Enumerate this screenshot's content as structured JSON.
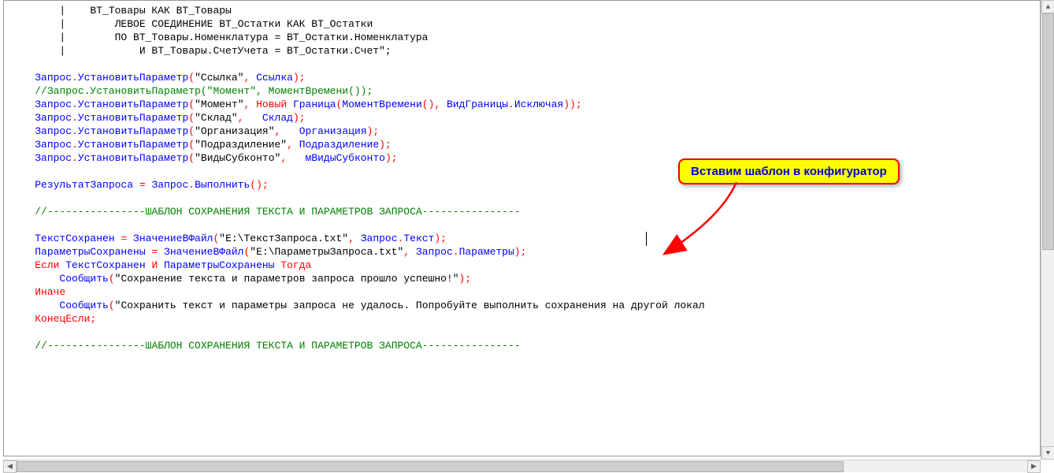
{
  "annotation": {
    "text": "Вставим шаблон в конфигуратор"
  },
  "code": {
    "lines": [
      [
        {
          "c": "black",
          "t": "        |    ВТ_Товары КАК ВТ_Товары"
        }
      ],
      [
        {
          "c": "black",
          "t": "        |        ЛЕВОЕ СОЕДИНЕНИЕ ВТ_Остатки КАК ВТ_Остатки"
        }
      ],
      [
        {
          "c": "black",
          "t": "        |        ПО ВТ_Товары.Номенклатура = ВТ_Остатки.Номенклатура"
        }
      ],
      [
        {
          "c": "black",
          "t": "        |            И ВТ_Товары.СчетУчета = ВТ_Остатки.Счет\""
        },
        {
          "c": "black",
          "t": ";"
        }
      ],
      [
        {
          "c": "black",
          "t": ""
        }
      ],
      [
        {
          "c": "black",
          "t": "    "
        },
        {
          "c": "blue",
          "t": "Запрос"
        },
        {
          "c": "red",
          "t": "."
        },
        {
          "c": "blue",
          "t": "УстановитьПараметр"
        },
        {
          "c": "red",
          "t": "("
        },
        {
          "c": "black",
          "t": "\"Ссылка\""
        },
        {
          "c": "red",
          "t": ", "
        },
        {
          "c": "blue",
          "t": "Ссылка"
        },
        {
          "c": "red",
          "t": ");"
        }
      ],
      [
        {
          "c": "black",
          "t": "    "
        },
        {
          "c": "green",
          "t": "//Запрос.УстановитьПараметр(\"Момент\", МоментВремени());"
        }
      ],
      [
        {
          "c": "black",
          "t": "    "
        },
        {
          "c": "blue",
          "t": "Запрос"
        },
        {
          "c": "red",
          "t": "."
        },
        {
          "c": "blue",
          "t": "УстановитьПараметр"
        },
        {
          "c": "red",
          "t": "("
        },
        {
          "c": "black",
          "t": "\"Момент\""
        },
        {
          "c": "red",
          "t": ", Новый "
        },
        {
          "c": "blue",
          "t": "Граница"
        },
        {
          "c": "red",
          "t": "("
        },
        {
          "c": "blue",
          "t": "МоментВремени"
        },
        {
          "c": "red",
          "t": "(), "
        },
        {
          "c": "blue",
          "t": "ВидГраницы"
        },
        {
          "c": "red",
          "t": "."
        },
        {
          "c": "blue",
          "t": "Исключая"
        },
        {
          "c": "red",
          "t": "));"
        }
      ],
      [
        {
          "c": "black",
          "t": "    "
        },
        {
          "c": "blue",
          "t": "Запрос"
        },
        {
          "c": "red",
          "t": "."
        },
        {
          "c": "blue",
          "t": "УстановитьПараметр"
        },
        {
          "c": "red",
          "t": "("
        },
        {
          "c": "black",
          "t": "\"Склад\""
        },
        {
          "c": "red",
          "t": ",   "
        },
        {
          "c": "blue",
          "t": "Склад"
        },
        {
          "c": "red",
          "t": ");"
        }
      ],
      [
        {
          "c": "black",
          "t": "    "
        },
        {
          "c": "blue",
          "t": "Запрос"
        },
        {
          "c": "red",
          "t": "."
        },
        {
          "c": "blue",
          "t": "УстановитьПараметр"
        },
        {
          "c": "red",
          "t": "("
        },
        {
          "c": "black",
          "t": "\"Организация\""
        },
        {
          "c": "red",
          "t": ",   "
        },
        {
          "c": "blue",
          "t": "Организация"
        },
        {
          "c": "red",
          "t": ");"
        }
      ],
      [
        {
          "c": "black",
          "t": "    "
        },
        {
          "c": "blue",
          "t": "Запрос"
        },
        {
          "c": "red",
          "t": "."
        },
        {
          "c": "blue",
          "t": "УстановитьПараметр"
        },
        {
          "c": "red",
          "t": "("
        },
        {
          "c": "black",
          "t": "\"Подраздиление\""
        },
        {
          "c": "red",
          "t": ", "
        },
        {
          "c": "blue",
          "t": "Подраздиление"
        },
        {
          "c": "red",
          "t": ");"
        }
      ],
      [
        {
          "c": "black",
          "t": "    "
        },
        {
          "c": "blue",
          "t": "Запрос"
        },
        {
          "c": "red",
          "t": "."
        },
        {
          "c": "blue",
          "t": "УстановитьПараметр"
        },
        {
          "c": "red",
          "t": "("
        },
        {
          "c": "black",
          "t": "\"ВидыСубконто\""
        },
        {
          "c": "red",
          "t": ",   "
        },
        {
          "c": "blue",
          "t": "мВидыСубконто"
        },
        {
          "c": "red",
          "t": ");"
        }
      ],
      [
        {
          "c": "black",
          "t": ""
        }
      ],
      [
        {
          "c": "black",
          "t": "    "
        },
        {
          "c": "blue",
          "t": "РезультатЗапроса "
        },
        {
          "c": "red",
          "t": "= "
        },
        {
          "c": "blue",
          "t": "Запрос"
        },
        {
          "c": "red",
          "t": "."
        },
        {
          "c": "blue",
          "t": "Выполнить"
        },
        {
          "c": "red",
          "t": "();"
        }
      ],
      [
        {
          "c": "black",
          "t": ""
        }
      ],
      [
        {
          "c": "black",
          "t": "    "
        },
        {
          "c": "green",
          "t": "//----------------ШАБЛОН СОХРАНЕНИЯ ТЕКСТА И ПАРАМЕТРОВ ЗАПРОСА----------------"
        }
      ],
      [
        {
          "c": "black",
          "t": ""
        }
      ],
      [
        {
          "c": "black",
          "t": "    "
        },
        {
          "c": "blue",
          "t": "ТекстСохранен "
        },
        {
          "c": "red",
          "t": "= "
        },
        {
          "c": "blue",
          "t": "ЗначениеВФайл"
        },
        {
          "c": "red",
          "t": "("
        },
        {
          "c": "black",
          "t": "\"E:\\ТекстЗапроса.txt\""
        },
        {
          "c": "red",
          "t": ", "
        },
        {
          "c": "blue",
          "t": "Запрос"
        },
        {
          "c": "red",
          "t": "."
        },
        {
          "c": "blue",
          "t": "Текст"
        },
        {
          "c": "red",
          "t": ");"
        }
      ],
      [
        {
          "c": "black",
          "t": "    "
        },
        {
          "c": "blue",
          "t": "ПараметрыСохранены "
        },
        {
          "c": "red",
          "t": "= "
        },
        {
          "c": "blue",
          "t": "ЗначениеВФайл"
        },
        {
          "c": "red",
          "t": "("
        },
        {
          "c": "black",
          "t": "\"E:\\ПараметрыЗапроса.txt\""
        },
        {
          "c": "red",
          "t": ", "
        },
        {
          "c": "blue",
          "t": "Запрос"
        },
        {
          "c": "red",
          "t": "."
        },
        {
          "c": "blue",
          "t": "Параметры"
        },
        {
          "c": "red",
          "t": ");"
        }
      ],
      [
        {
          "c": "black",
          "t": "    "
        },
        {
          "c": "red",
          "t": "Если "
        },
        {
          "c": "blue",
          "t": "ТекстСохранен "
        },
        {
          "c": "red",
          "t": "И "
        },
        {
          "c": "blue",
          "t": "ПараметрыСохранены "
        },
        {
          "c": "red",
          "t": "Тогда"
        }
      ],
      [
        {
          "c": "black",
          "t": "        "
        },
        {
          "c": "blue",
          "t": "Сообщить"
        },
        {
          "c": "red",
          "t": "("
        },
        {
          "c": "black",
          "t": "\"Сохранение текста и параметров запроса прошло успешно!\""
        },
        {
          "c": "red",
          "t": ");"
        }
      ],
      [
        {
          "c": "black",
          "t": "    "
        },
        {
          "c": "red",
          "t": "Иначе"
        }
      ],
      [
        {
          "c": "black",
          "t": "        "
        },
        {
          "c": "blue",
          "t": "Сообщить"
        },
        {
          "c": "red",
          "t": "("
        },
        {
          "c": "black",
          "t": "\"Сохранить текст и параметры запроса не удалось. Попробуйте выполнить сохранения на другой локал"
        }
      ],
      [
        {
          "c": "black",
          "t": "    "
        },
        {
          "c": "red",
          "t": "КонецЕсли;"
        }
      ],
      [
        {
          "c": "black",
          "t": ""
        }
      ],
      [
        {
          "c": "black",
          "t": "    "
        },
        {
          "c": "green",
          "t": "//----------------ШАБЛОН СОХРАНЕНИЯ ТЕКСТА И ПАРАМЕТРОВ ЗАПРОСА----------------"
        }
      ]
    ]
  }
}
